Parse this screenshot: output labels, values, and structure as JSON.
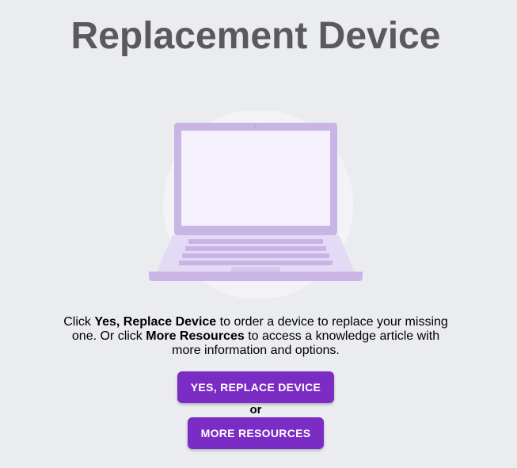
{
  "page": {
    "title": "Replacement Device"
  },
  "description": {
    "part1": "Click ",
    "bold1": "Yes, Replace Device",
    "part2": " to order a device to replace your missing one. Or click ",
    "bold2": "More Resources",
    "part3": " to access a knowledge article with more information and options."
  },
  "actions": {
    "primary_label": "YES, REPLACE DEVICE",
    "separator": "or",
    "secondary_label": "MORE RESOURCES"
  },
  "illustration": {
    "icon": "laptop-icon"
  },
  "colors": {
    "background": "#ebecf0",
    "title": "#5a5a5c",
    "button": "#7b2cc5",
    "laptop_frame": "#c9b5e5",
    "laptop_screen": "#f4f1fd",
    "circle": "#f3f2f6"
  }
}
